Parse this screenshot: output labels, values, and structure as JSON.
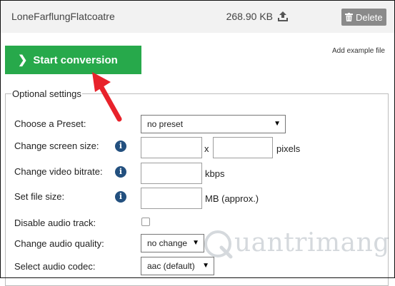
{
  "file": {
    "name": "LoneFarflungFlatcoatre",
    "size": "268.90 KB",
    "upload_icon": "upload-icon",
    "delete_label": "Delete",
    "delete_icon": "trash-icon"
  },
  "actions": {
    "start_label": "Start conversion",
    "add_example_label": "Add example file"
  },
  "settings": {
    "legend": "Optional settings",
    "preset": {
      "label": "Choose a Preset:",
      "value": "no preset"
    },
    "screen_size": {
      "label": "Change screen size:",
      "separator": "x",
      "unit": "pixels"
    },
    "video_bitrate": {
      "label": "Change video bitrate:",
      "unit": "kbps"
    },
    "file_size": {
      "label": "Set file size:",
      "unit": "MB (approx.)"
    },
    "disable_audio": {
      "label": "Disable audio track:"
    },
    "audio_quality": {
      "label": "Change audio quality:",
      "value": "no change"
    },
    "audio_codec": {
      "label": "Select audio codec:",
      "value": "aac (default)"
    }
  },
  "watermark": {
    "text": "uantrimang"
  },
  "colors": {
    "start_button": "#27a94b",
    "delete_button": "#8a8a8a",
    "info_icon": "#23507f",
    "arrow": "#e8222b"
  }
}
